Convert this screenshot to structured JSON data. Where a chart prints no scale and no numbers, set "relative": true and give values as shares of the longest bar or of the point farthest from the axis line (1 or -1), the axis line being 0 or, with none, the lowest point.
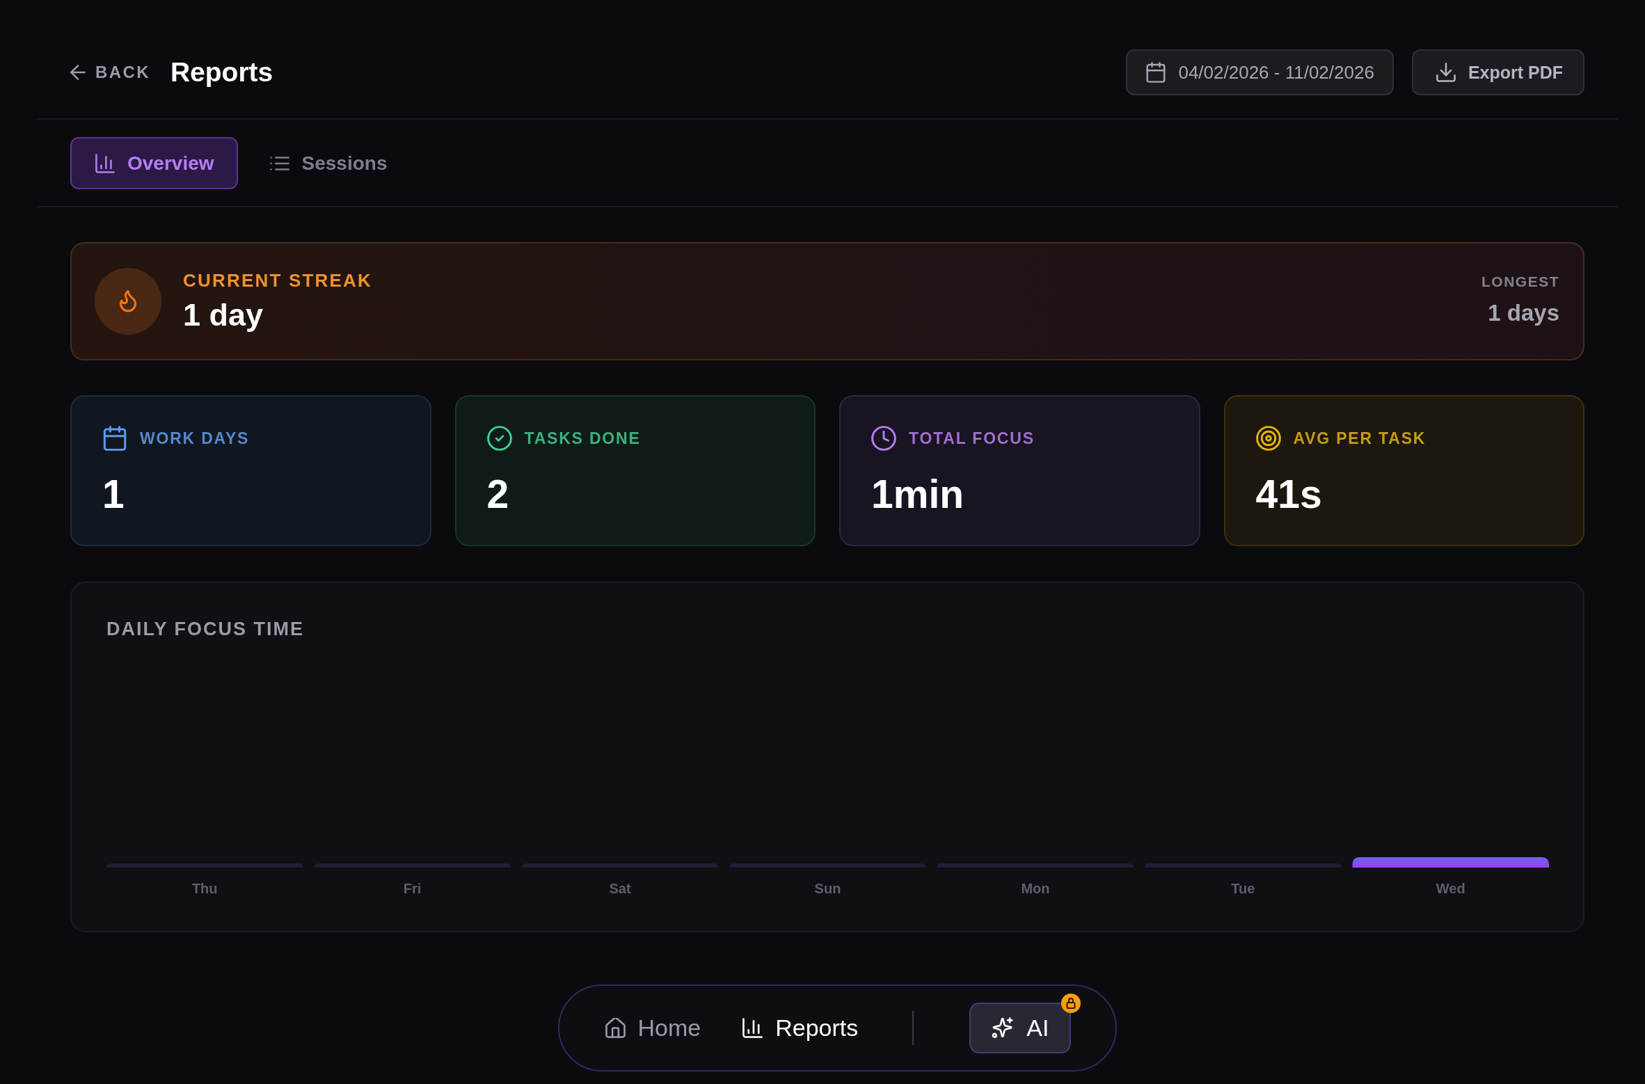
{
  "header": {
    "back": {
      "label": "BACK"
    },
    "title": "Reports",
    "date_range": {
      "label": "04/02/2026 - 11/02/2026"
    },
    "export": {
      "label": "Export PDF"
    }
  },
  "tabs": [
    {
      "kind": "chart",
      "label": "Overview",
      "selected": true
    },
    {
      "kind": "list",
      "label": "Sessions",
      "selected": false
    }
  ],
  "streak": {
    "label": "CURRENT STREAK",
    "value": "1 day",
    "longest_label": "LONGEST",
    "longest_value": "1 days"
  },
  "stats": [
    {
      "kind": "days",
      "label": "WORK DAYS",
      "value": "1",
      "color": "#5b9cf2"
    },
    {
      "kind": "tasks",
      "label": "TASKS DONE",
      "value": "2",
      "color": "#3ecf8e"
    },
    {
      "kind": "time",
      "label": "TOTAL FOCUS",
      "value": "1min",
      "color": "#b87cf5"
    },
    {
      "kind": "average",
      "label": "AVG PER TASK",
      "value": "41s",
      "color": "#eab308"
    }
  ],
  "chart": {
    "chart_data": {
      "type": "bar",
      "title": "DAILY FOCUS TIME",
      "categories": [
        "Thu",
        "Fri",
        "Sat",
        "Sun",
        "Mon",
        "Tue",
        "Wed"
      ],
      "values": [
        0,
        0,
        0,
        0,
        0,
        0,
        1
      ],
      "relative": true
    }
  },
  "nav": {
    "items": [
      {
        "kind": "home",
        "label": "Home",
        "selected": false
      },
      {
        "kind": "reports",
        "label": "Reports",
        "selected": true
      }
    ],
    "ai_button": {
      "label": "AI",
      "locked": true
    }
  }
}
